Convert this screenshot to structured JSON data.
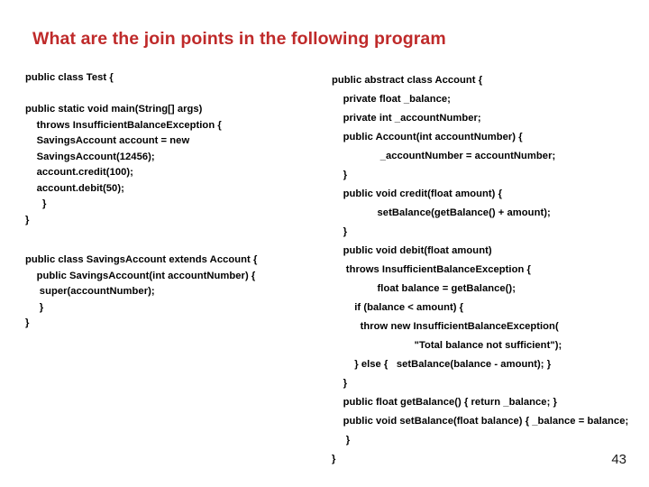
{
  "slide": {
    "title": "What are the join points in the following program",
    "title_color": "#bf2a2a",
    "page_number": "43",
    "background_color": "#ffffff",
    "code_color": "#000000"
  },
  "left_column": {
    "block_test_class": [
      "public class Test {",
      "",
      "public static void main(String[] args)",
      "    throws InsufficientBalanceException {",
      "    SavingsAccount account = new",
      "    SavingsAccount(12456);",
      "    account.credit(100);",
      "    account.debit(50);",
      "      }",
      "}"
    ],
    "block_savings_account_class": [
      "public class SavingsAccount extends Account {",
      "    public SavingsAccount(int accountNumber) {",
      "     super(accountNumber);",
      "     }",
      "}"
    ]
  },
  "right_column": {
    "block_account_class": [
      "public abstract class Account {",
      "    private float _balance;",
      "    private int _accountNumber;",
      "    public Account(int accountNumber) {",
      "                 _accountNumber = accountNumber;",
      "    }",
      "    public void credit(float amount) {",
      "                setBalance(getBalance() + amount);",
      "    }",
      "    public void debit(float amount)",
      "     throws InsufficientBalanceException {",
      "                float balance = getBalance();",
      "        if (balance < amount) {",
      "          throw new InsufficientBalanceException(",
      "                             \"Total balance not sufficient\");",
      "        } else {   setBalance(balance - amount); }",
      "    }",
      "    public float getBalance() { return _balance; }",
      "    public void setBalance(float balance) { _balance = balance;",
      "     }",
      "}"
    ]
  }
}
